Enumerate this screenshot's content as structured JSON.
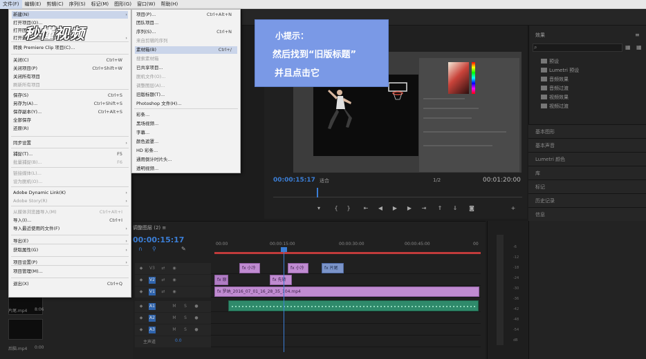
{
  "menubar": {
    "items": [
      "文件(F)",
      "编辑(E)",
      "剪辑(C)",
      "序列(S)",
      "标记(M)",
      "图形(G)",
      "窗口(W)",
      "帮助(H)"
    ]
  },
  "file_menu": {
    "items": [
      {
        "label": "新建(N)",
        "shortcut": "",
        "arrow": "›",
        "state": "highlight"
      },
      {
        "label": "打开项目(O)...",
        "shortcut": "",
        "arrow": "",
        "state": "normal"
      },
      {
        "label": "打开团队项目...",
        "shortcut": "",
        "arrow": "",
        "state": "normal"
      },
      {
        "label": "打开最近使用的内容(E)",
        "shortcut": "",
        "arrow": "›",
        "state": "normal"
      },
      {
        "label": "转换 Premiere Clip 项目(C)...",
        "shortcut": "",
        "arrow": "",
        "state": "normal"
      },
      {
        "label": "关闭(C)",
        "shortcut": "Ctrl+W",
        "arrow": "",
        "state": "normal"
      },
      {
        "label": "关闭项目(P)",
        "shortcut": "Ctrl+Shift+W",
        "arrow": "",
        "state": "normal"
      },
      {
        "label": "关闭所有项目",
        "shortcut": "",
        "arrow": "",
        "state": "normal"
      },
      {
        "label": "刷新所有项目",
        "shortcut": "",
        "arrow": "",
        "state": "disabled"
      },
      {
        "label": "保存(S)",
        "shortcut": "Ctrl+S",
        "arrow": "",
        "state": "normal"
      },
      {
        "label": "另存为(A)...",
        "shortcut": "Ctrl+Shift+S",
        "arrow": "",
        "state": "normal"
      },
      {
        "label": "保存副本(Y)...",
        "shortcut": "Ctrl+Alt+S",
        "arrow": "",
        "state": "normal"
      },
      {
        "label": "全部保存",
        "shortcut": "",
        "arrow": "",
        "state": "normal"
      },
      {
        "label": "还原(R)",
        "shortcut": "",
        "arrow": "",
        "state": "normal"
      },
      {
        "label": "同步设置",
        "shortcut": "",
        "arrow": "›",
        "state": "normal"
      },
      {
        "label": "捕捉(T)...",
        "shortcut": "F5",
        "arrow": "",
        "state": "normal"
      },
      {
        "label": "批量捕捉(B)...",
        "shortcut": "F6",
        "arrow": "",
        "state": "disabled"
      },
      {
        "label": "链接媒体(L)...",
        "shortcut": "",
        "arrow": "",
        "state": "disabled"
      },
      {
        "label": "设为脱机(O)...",
        "shortcut": "",
        "arrow": "",
        "state": "disabled"
      },
      {
        "label": "Adobe Dynamic Link(K)",
        "shortcut": "",
        "arrow": "›",
        "state": "normal"
      },
      {
        "label": "Adobe Story(R)",
        "shortcut": "",
        "arrow": "›",
        "state": "disabled"
      },
      {
        "label": "从媒体浏览器导入(M)",
        "shortcut": "Ctrl+Alt+I",
        "arrow": "",
        "state": "disabled"
      },
      {
        "label": "导入(I)...",
        "shortcut": "Ctrl+I",
        "arrow": "",
        "state": "normal"
      },
      {
        "label": "导入最近使用的文件(F)",
        "shortcut": "",
        "arrow": "›",
        "state": "normal"
      },
      {
        "label": "导出(E)",
        "shortcut": "",
        "arrow": "›",
        "state": "normal"
      },
      {
        "label": "获取属性(G)",
        "shortcut": "",
        "arrow": "›",
        "state": "normal"
      },
      {
        "label": "项目设置(P)",
        "shortcut": "",
        "arrow": "›",
        "state": "normal"
      },
      {
        "label": "项目管理(M)...",
        "shortcut": "",
        "arrow": "",
        "state": "normal"
      },
      {
        "label": "退出(X)",
        "shortcut": "Ctrl+Q",
        "arrow": "",
        "state": "normal"
      }
    ]
  },
  "new_menu": {
    "items": [
      {
        "label": "项目(P)...",
        "shortcut": "Ctrl+Alt+N",
        "state": "normal"
      },
      {
        "label": "团队项目...",
        "shortcut": "",
        "state": "normal"
      },
      {
        "label": "序列(S)...",
        "shortcut": "Ctrl+N",
        "state": "normal"
      },
      {
        "label": "来自剪辑的序列",
        "shortcut": "",
        "state": "disabled"
      },
      {
        "label": "素材箱(B)",
        "shortcut": "Ctrl+/",
        "state": "highlight"
      },
      {
        "label": "搜索素材箱",
        "shortcut": "",
        "state": "disabled"
      },
      {
        "label": "已共享项目...",
        "shortcut": "",
        "state": "normal"
      },
      {
        "label": "脱机文件(O)...",
        "shortcut": "",
        "state": "disabled"
      },
      {
        "label": "调整图层(A)...",
        "shortcut": "",
        "state": "disabled"
      },
      {
        "label": "旧版标题(T)...",
        "shortcut": "",
        "state": "normal"
      },
      {
        "label": "Photoshop 文件(H)...",
        "shortcut": "",
        "state": "normal"
      },
      {
        "label": "彩条...",
        "shortcut": "",
        "state": "normal"
      },
      {
        "label": "黑场视频...",
        "shortcut": "",
        "state": "normal"
      },
      {
        "label": "字幕...",
        "shortcut": "",
        "state": "normal"
      },
      {
        "label": "颜色遮罩...",
        "shortcut": "",
        "state": "normal"
      },
      {
        "label": "HD 彩条...",
        "shortcut": "",
        "state": "normal"
      },
      {
        "label": "通用倒计时片头...",
        "shortcut": "",
        "state": "normal"
      },
      {
        "label": "透明视频...",
        "shortcut": "",
        "state": "normal"
      }
    ]
  },
  "tip": {
    "title": "小提示：",
    "line1": "然后找到“旧版标题”",
    "line2": "并且点击它"
  },
  "watermark": {
    "text": "秒懂视频"
  },
  "program_monitor": {
    "current_tc": "00:00:15:17",
    "fit": "适合",
    "resolution": "1/2",
    "duration_tc": "00:01:20:00"
  },
  "effects_panel": {
    "title": "效果",
    "items": [
      "预设",
      "Lumetri 预设",
      "音频效果",
      "音频过渡",
      "视频效果",
      "视频过渡"
    ],
    "sections": [
      "基本图形",
      "基本声音",
      "Lumetri 颜色",
      "库",
      "标记",
      "历史记录",
      "信息"
    ]
  },
  "timeline": {
    "title": "调整图层 (2) ≡",
    "tc": "00:00:15:17",
    "ticks": [
      "00:00",
      "00:00:15:00",
      "00:00:30:00",
      "00:00:45:00",
      "00"
    ],
    "clips": [
      {
        "track": "v3",
        "label": "fx 小冷"
      },
      {
        "track": "v3",
        "label": "fx 小冷"
      },
      {
        "track": "v3b",
        "label": "fx 片尾"
      },
      {
        "track": "v2",
        "label": "fx 原"
      },
      {
        "track": "v2",
        "label": "fx 先转"
      },
      {
        "track": "v1",
        "label": "fx 罗纳_2016_07_01_16_28_35_104.mp4"
      }
    ],
    "track_labels": [
      "V3",
      "V2",
      "V1",
      "A1",
      "A2",
      "A3"
    ],
    "master_label": "主声道",
    "master_value": "0.0"
  },
  "meter": {
    "ticks": [
      "-6",
      "-12",
      "-18",
      "-24",
      "-30",
      "-36",
      "-42",
      "-48",
      "-54"
    ],
    "unit": "dB"
  },
  "project_panel": {
    "items": [
      {
        "label": "片尾.mp4"
      },
      {
        "label": "后脑.mp4"
      }
    ],
    "durations": [
      "8:06",
      "0:00"
    ]
  },
  "colors": {
    "accent": "#3b7ed6",
    "tip_bg": "#7a99e6",
    "clip_video": "#c08bd1",
    "clip_audio": "#2f8a6b",
    "menu_highlight": "#cad5ea"
  }
}
